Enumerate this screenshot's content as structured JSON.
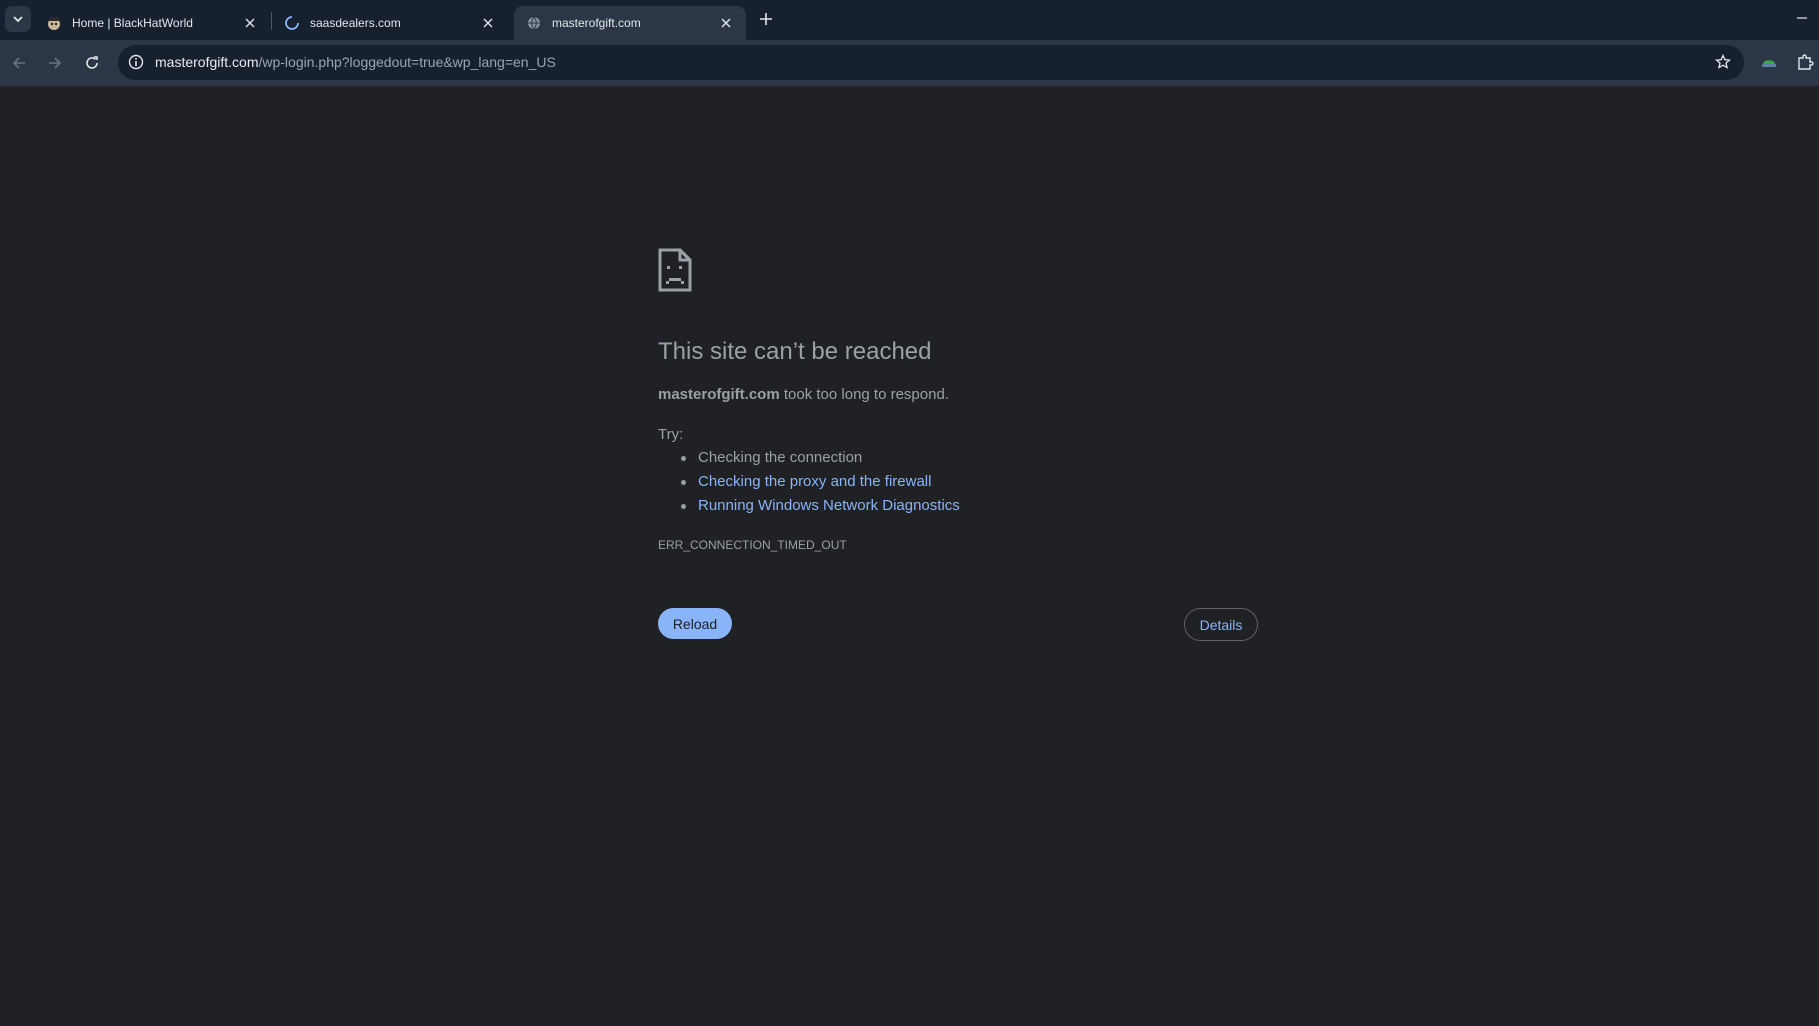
{
  "browser": {
    "tabs": [
      {
        "title": "Home | BlackHatWorld",
        "favicon": "blackhatworld-favicon-icon",
        "active": false,
        "loading": false
      },
      {
        "title": "saasdealers.com",
        "favicon": "loading-spinner-icon",
        "active": false,
        "loading": true
      },
      {
        "title": "masterofgift.com",
        "favicon": "globe-icon",
        "active": true,
        "loading": false
      }
    ],
    "omnibox": {
      "host": "masterofgift.com",
      "path": "/wp-login.php?loggedout=true&wp_lang=en_US"
    }
  },
  "error_page": {
    "title": "This site can’t be reached",
    "host": "masterofgift.com",
    "desc_suffix": " took too long to respond.",
    "try_label": "Try:",
    "suggestions": [
      "Checking the connection",
      "Checking the proxy and the firewall",
      "Running Windows Network Diagnostics"
    ],
    "error_code": "ERR_CONNECTION_TIMED_OUT",
    "reload_label": "Reload",
    "details_label": "Details"
  },
  "colors": {
    "tab_strip_bg": "#16202e",
    "toolbar_bg": "#2b3646",
    "page_bg": "#202124",
    "text_secondary": "#9aa0a6",
    "link": "#8ab4f8"
  }
}
